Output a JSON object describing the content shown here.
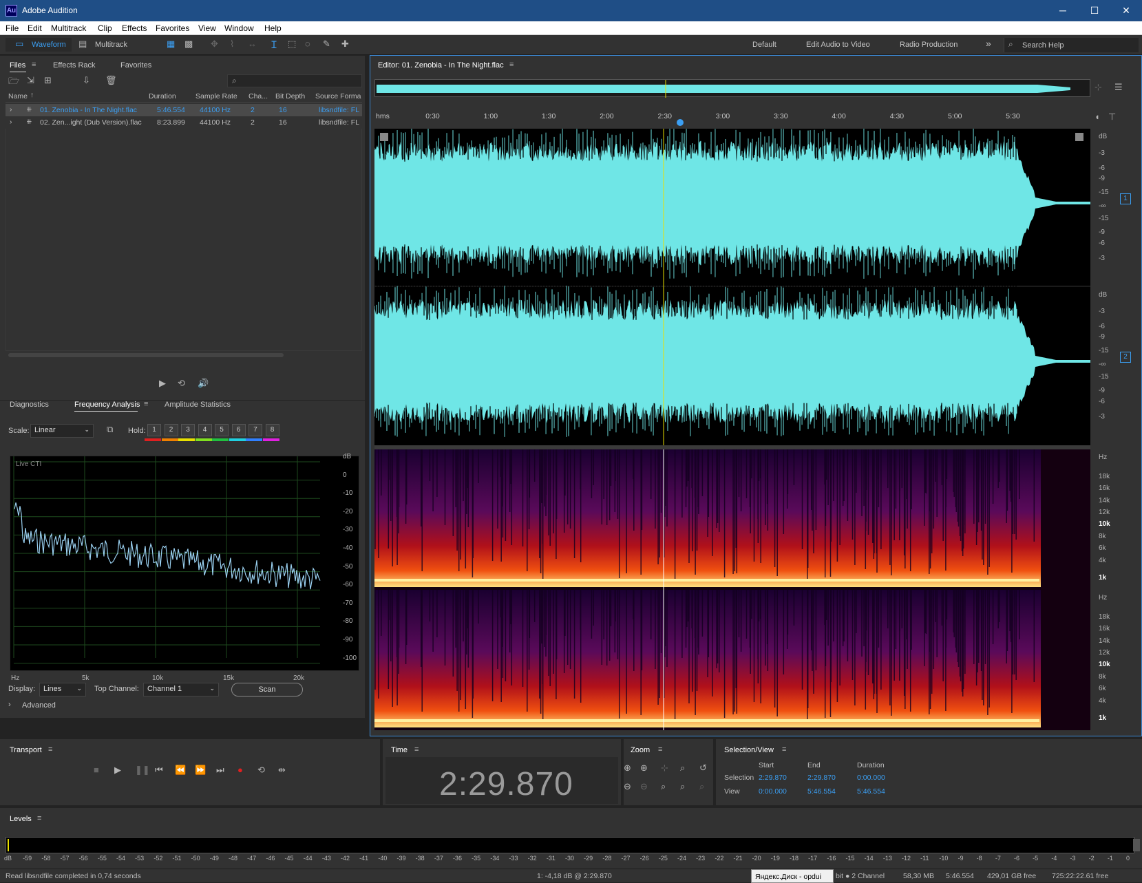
{
  "window": {
    "app_title": "Adobe Audition",
    "logo": "Au",
    "minimize": "─",
    "maximize": "☐",
    "close": "✕"
  },
  "menu": [
    "File",
    "Edit",
    "Multitrack",
    "Clip",
    "Effects",
    "Favorites",
    "View",
    "Window",
    "Help"
  ],
  "toolbar": {
    "waveform": "Waveform",
    "multitrack": "Multitrack",
    "workspaces": [
      "Default",
      "Edit Audio to Video",
      "Radio Production"
    ],
    "more": "»",
    "search": "Search Help"
  },
  "files_panel": {
    "tabs": [
      "Files",
      "Effects Rack",
      "Favorites"
    ],
    "columns": [
      "Name",
      "Duration",
      "Sample Rate",
      "Cha...",
      "Bit Depth",
      "Source Forma"
    ],
    "rows": [
      {
        "name": "01. Zenobia - In The Night.flac",
        "duration": "5:46.554",
        "rate": "44100 Hz",
        "ch": "2",
        "bits": "16",
        "src": "libsndfile: FL"
      },
      {
        "name": "02. Zen...ight (Dub Version).flac",
        "duration": "8:23.899",
        "rate": "44100 Hz",
        "ch": "2",
        "bits": "16",
        "src": "libsndfile: FL"
      }
    ]
  },
  "analysis_panel": {
    "tabs": [
      "Diagnostics",
      "Frequency Analysis",
      "Amplitude Statistics"
    ],
    "scale_label": "Scale:",
    "scale_value": "Linear",
    "hold_label": "Hold:",
    "hold": [
      "1",
      "2",
      "3",
      "4",
      "5",
      "6",
      "7",
      "8"
    ],
    "hold_colors": [
      "#e02020",
      "#f08000",
      "#e8e000",
      "#80e020",
      "#20c040",
      "#20d0e0",
      "#3080ff",
      "#e020e0"
    ],
    "live_label": "Live CTI",
    "db_ticks": [
      "dB",
      "0",
      "-10",
      "-20",
      "-30",
      "-40",
      "-50",
      "-60",
      "-70",
      "-80",
      "-90",
      "-100"
    ],
    "hz_ticks": [
      "Hz",
      "5k",
      "10k",
      "15k",
      "20k"
    ],
    "display_label": "Display:",
    "display_value": "Lines",
    "top_channel_label": "Top Channel:",
    "top_channel_value": "Channel 1",
    "scan": "Scan",
    "advanced": "Advanced"
  },
  "editor": {
    "title": "Editor: 01. Zenobia - In The Night.flac",
    "ruler": [
      "hms",
      "0:30",
      "1:00",
      "1:30",
      "2:00",
      "2:30",
      "3:00",
      "3:30",
      "4:00",
      "4:30",
      "5:00",
      "5:30"
    ],
    "db_scale": [
      "dB",
      "-3",
      "-6",
      "-9",
      "-15",
      "-∞",
      "-15",
      "-9",
      "-6",
      "-3"
    ],
    "channels": [
      "1",
      "2"
    ],
    "hz_scale": [
      "Hz",
      "18k",
      "16k",
      "14k",
      "12k",
      "10k",
      "8k",
      "6k",
      "4k",
      "1k"
    ]
  },
  "transport": {
    "title": "Transport"
  },
  "time": {
    "title": "Time",
    "value": "2:29.870"
  },
  "zoom": {
    "title": "Zoom"
  },
  "selection": {
    "title": "Selection/View",
    "headers": [
      "Start",
      "End",
      "Duration"
    ],
    "selection_label": "Selection",
    "view_label": "View",
    "selection": [
      "2:29.870",
      "2:29.870",
      "0:00.000"
    ],
    "view": [
      "0:00.000",
      "5:46.554",
      "5:46.554"
    ]
  },
  "levels": {
    "title": "Levels",
    "ticks": [
      "dB",
      "-59",
      "-58",
      "-57",
      "-56",
      "-55",
      "-54",
      "-53",
      "-52",
      "-51",
      "-50",
      "-49",
      "-48",
      "-47",
      "-46",
      "-45",
      "-44",
      "-43",
      "-42",
      "-41",
      "-40",
      "-39",
      "-38",
      "-37",
      "-36",
      "-35",
      "-34",
      "-33",
      "-32",
      "-31",
      "-30",
      "-29",
      "-28",
      "-27",
      "-26",
      "-25",
      "-24",
      "-23",
      "-22",
      "-21",
      "-20",
      "-19",
      "-18",
      "-17",
      "-16",
      "-15",
      "-14",
      "-13",
      "-12",
      "-11",
      "-10",
      "-9",
      "-8",
      "-7",
      "-6",
      "-5",
      "-4",
      "-3",
      "-2",
      "-1",
      "0"
    ]
  },
  "status": {
    "left": "Read libsndfile completed in 0,74 seconds",
    "cursor": "1: -4,18 dB @ 2:29.870",
    "tooltip": "Яндекс.Диск - opdui",
    "format": "bit ● 2 Channel",
    "mem": "58,30 MB",
    "dur": "5:46.554",
    "free": "429,01 GB free",
    "time_free": "725:22:22.61 free"
  }
}
